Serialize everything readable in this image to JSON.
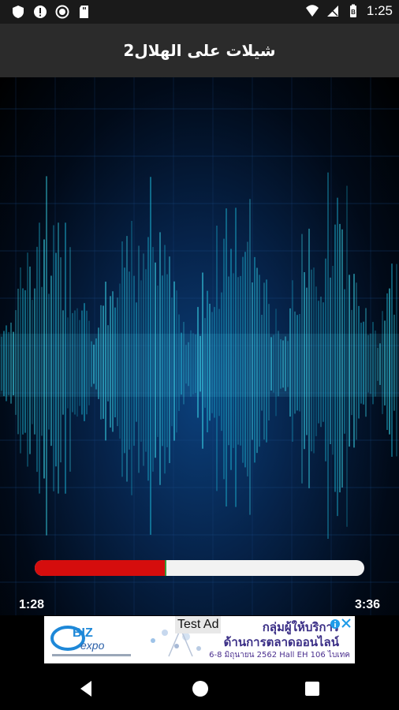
{
  "status_bar": {
    "time": "1:25",
    "left_icons": [
      "shield-icon",
      "alert-icon",
      "circle-icon",
      "sd-card-icon"
    ],
    "right_icons": [
      "wifi-icon",
      "no-sim-icon",
      "battery-icon"
    ]
  },
  "app_bar": {
    "title": "شيلات على الهلال2"
  },
  "player": {
    "elapsed": "1:28",
    "total": "3:36",
    "progress_fraction": 0.4,
    "progress_color": "#d50d0d",
    "stop_icon": "stop-icon",
    "equalizer_icon": "equalizer-icon",
    "background": "audio-waveform-image"
  },
  "ad": {
    "badge": "Test Ad",
    "logo_text": "BIZ expo",
    "line1": "กลุ่มผู้ให้บริการ",
    "line2": "ด้านการตลาดออนไลน์",
    "line3": "6-8 มิถุนายน 2562  Hall EH 106 ไบเทค",
    "info_icon": "ad-info-icon",
    "close_icon": "ad-close-icon"
  },
  "nav_bar": {
    "icons": [
      "back-icon",
      "home-icon",
      "recent-apps-icon"
    ]
  },
  "colors": {
    "progress_fill": "#d50d0d",
    "progress_track": "#f2f2f2",
    "app_bar": "#2b2b2b",
    "ad_text": "#3a2e86"
  }
}
